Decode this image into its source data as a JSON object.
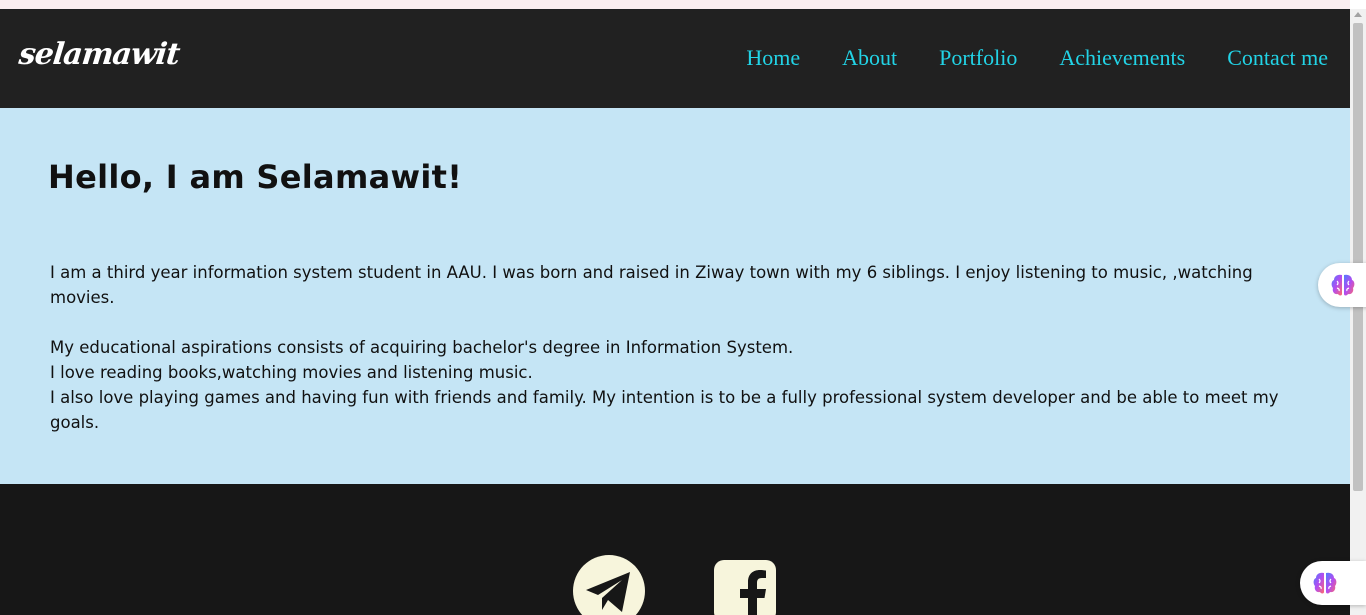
{
  "brand": {
    "logo_text": "selamawit"
  },
  "nav": {
    "items": [
      {
        "label": "Home"
      },
      {
        "label": "About"
      },
      {
        "label": "Portfolio"
      },
      {
        "label": "Achievements"
      },
      {
        "label": "Contact me"
      }
    ]
  },
  "hero": {
    "heading": "Hello, I am Selamawit!",
    "paragraphs": {
      "intro": "I am a third year information system student in AAU. I was born and raised in Ziway town with my 6 siblings. I enjoy listening to music, ,watching movies.",
      "aspirations": "My educational aspirations consists of acquiring bachelor's degree in Information System.",
      "hobbies": "I love reading books,watching movies and listening music.",
      "goals": "I also love playing games and having fun with friends and family. My intention is to be a fully professional system developer and be able to meet my goals."
    }
  },
  "footer": {
    "icons": [
      "telegram-icon",
      "facebook-icon"
    ]
  },
  "colors": {
    "nav_background": "#212121",
    "nav_link": "#22d3e6",
    "hero_background": "#c5e5f5",
    "footer_background": "#171717",
    "social_icon": "#f7f5dc"
  }
}
